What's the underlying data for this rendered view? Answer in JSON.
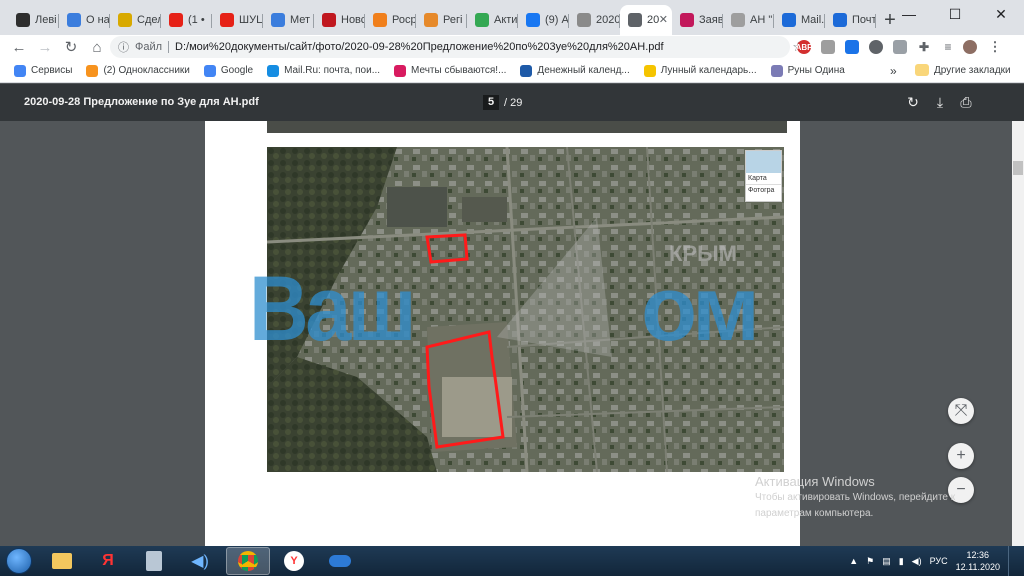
{
  "tabs": [
    {
      "label": "Леві",
      "color": "#2e2e2e"
    },
    {
      "label": "О на",
      "color": "#3b7ddd"
    },
    {
      "label": "Сдел",
      "color": "#d8a900"
    },
    {
      "label": "(1 •",
      "color": "#e62117"
    },
    {
      "label": "ШУЦ",
      "color": "#e62117"
    },
    {
      "label": "Мет",
      "color": "#3b7ddd"
    },
    {
      "label": "Новс",
      "color": "#c0171f"
    },
    {
      "label": "Роср",
      "color": "#f07f1b"
    },
    {
      "label": "Регі",
      "color": "#e6892a"
    },
    {
      "label": "Акти",
      "color": "#34a853"
    },
    {
      "label": "(9) А",
      "color": "#1877f2"
    },
    {
      "label": "2020",
      "color": "#8a8a8a"
    },
    {
      "label": "20",
      "color": "#5f6368",
      "active": true
    },
    {
      "label": "Заяв",
      "color": "#c2185b"
    },
    {
      "label": "АН \"",
      "color": "#9e9e9e"
    },
    {
      "label": "Mail.",
      "color": "#1c6ad8"
    },
    {
      "label": "Почт",
      "color": "#1c6ad8"
    }
  ],
  "new_tab_label": "+",
  "window_controls": {
    "minimize": "—",
    "maximize": "☐",
    "close": "✕"
  },
  "omnibox": {
    "scheme_label": "Файл",
    "url": "D:/мои%20документы/сайт/фото/2020-09-28%20Предложение%20по%203уе%20для%20АН.pdf"
  },
  "bookmarks": [
    {
      "label": "Сервисы",
      "color": "#4285f4"
    },
    {
      "label": "(2) Одноклассники",
      "color": "#f7931e"
    },
    {
      "label": "Google",
      "color": "#4285f4"
    },
    {
      "label": "Mail.Ru: почта, пои...",
      "color": "#168de2"
    },
    {
      "label": "Мечты сбываются!...",
      "color": "#d81b60"
    },
    {
      "label": "Денежный календ...",
      "color": "#1e5aa8"
    },
    {
      "label": "Лунный календарь...",
      "color": "#f5c400"
    },
    {
      "label": "Руны Одина",
      "color": "#7b7bb5"
    }
  ],
  "bookmarks_more": "»",
  "other_bookmarks": "Другие закладки",
  "pdf": {
    "title": "2020-09-28 Предложение по Зуе для АН.pdf",
    "current_page": "5",
    "total_pages": "/ 29"
  },
  "map": {
    "layer_map_label": "Карта",
    "layer_photo_label": "Фотогра",
    "watermark_left": "Ваш",
    "watermark_right": "ом",
    "watermark_small": "КРЫМ"
  },
  "zoom": {
    "fit": "⤧",
    "plus": "+",
    "minus": "−"
  },
  "activation": {
    "title": "Активация Windows",
    "line1": "Чтобы активировать Windows, перейдите к",
    "line2": "параметрам компьютера."
  },
  "tray": {
    "language": "РУС",
    "time": "12:36",
    "date": "12.11.2020"
  }
}
